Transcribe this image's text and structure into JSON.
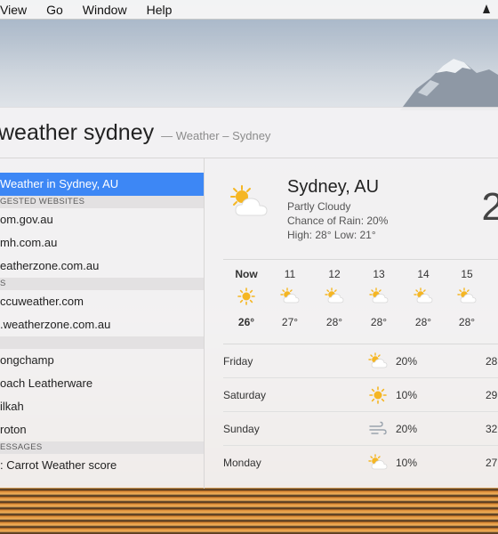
{
  "menubar": {
    "items": [
      "View",
      "Go",
      "Window",
      "Help"
    ]
  },
  "search": {
    "query": "weather sydney",
    "hint": "— Weather – Sydney"
  },
  "results": {
    "top_hit": "Weather in Sydney, AU",
    "sections": [
      {
        "header": "GESTED WEBSITES",
        "items": [
          "om.gov.au",
          "mh.com.au",
          "eatherzone.com.au"
        ]
      },
      {
        "header": "S",
        "items": [
          "ccuweather.com",
          ".weatherzone.com.au"
        ]
      },
      {
        "header": "",
        "items": [
          "ongchamp",
          "oach Leatherware",
          "ilkah",
          "roton"
        ]
      },
      {
        "header": "ESSAGES",
        "items": [
          ": Carrot Weather score"
        ]
      }
    ]
  },
  "weather": {
    "city": "Sydney, AU",
    "condition": "Partly Cloudy",
    "chance_of_rain": "Chance of Rain: 20%",
    "high_low": "High: 28° Low: 21°",
    "current_temp": "2",
    "hourly": [
      {
        "label": "Now",
        "icon": "sun-icon",
        "temp": "26°",
        "now": true
      },
      {
        "label": "11",
        "icon": "partly-cloudy-icon",
        "temp": "27°"
      },
      {
        "label": "12",
        "icon": "partly-cloudy-icon",
        "temp": "28°"
      },
      {
        "label": "13",
        "icon": "partly-cloudy-icon",
        "temp": "28°"
      },
      {
        "label": "14",
        "icon": "partly-cloudy-icon",
        "temp": "28°"
      },
      {
        "label": "15",
        "icon": "partly-cloudy-icon",
        "temp": "28°"
      }
    ],
    "daily": [
      {
        "day": "Friday",
        "icon": "partly-cloudy-icon",
        "rain": "20%",
        "high": "28"
      },
      {
        "day": "Saturday",
        "icon": "sun-icon",
        "rain": "10%",
        "high": "29"
      },
      {
        "day": "Sunday",
        "icon": "windy-icon",
        "rain": "20%",
        "high": "32"
      },
      {
        "day": "Monday",
        "icon": "partly-cloudy-icon",
        "rain": "10%",
        "high": "27"
      }
    ]
  },
  "colors": {
    "selection": "#3d87f5",
    "sun": "#f5b623",
    "cloud": "#ffffff"
  }
}
